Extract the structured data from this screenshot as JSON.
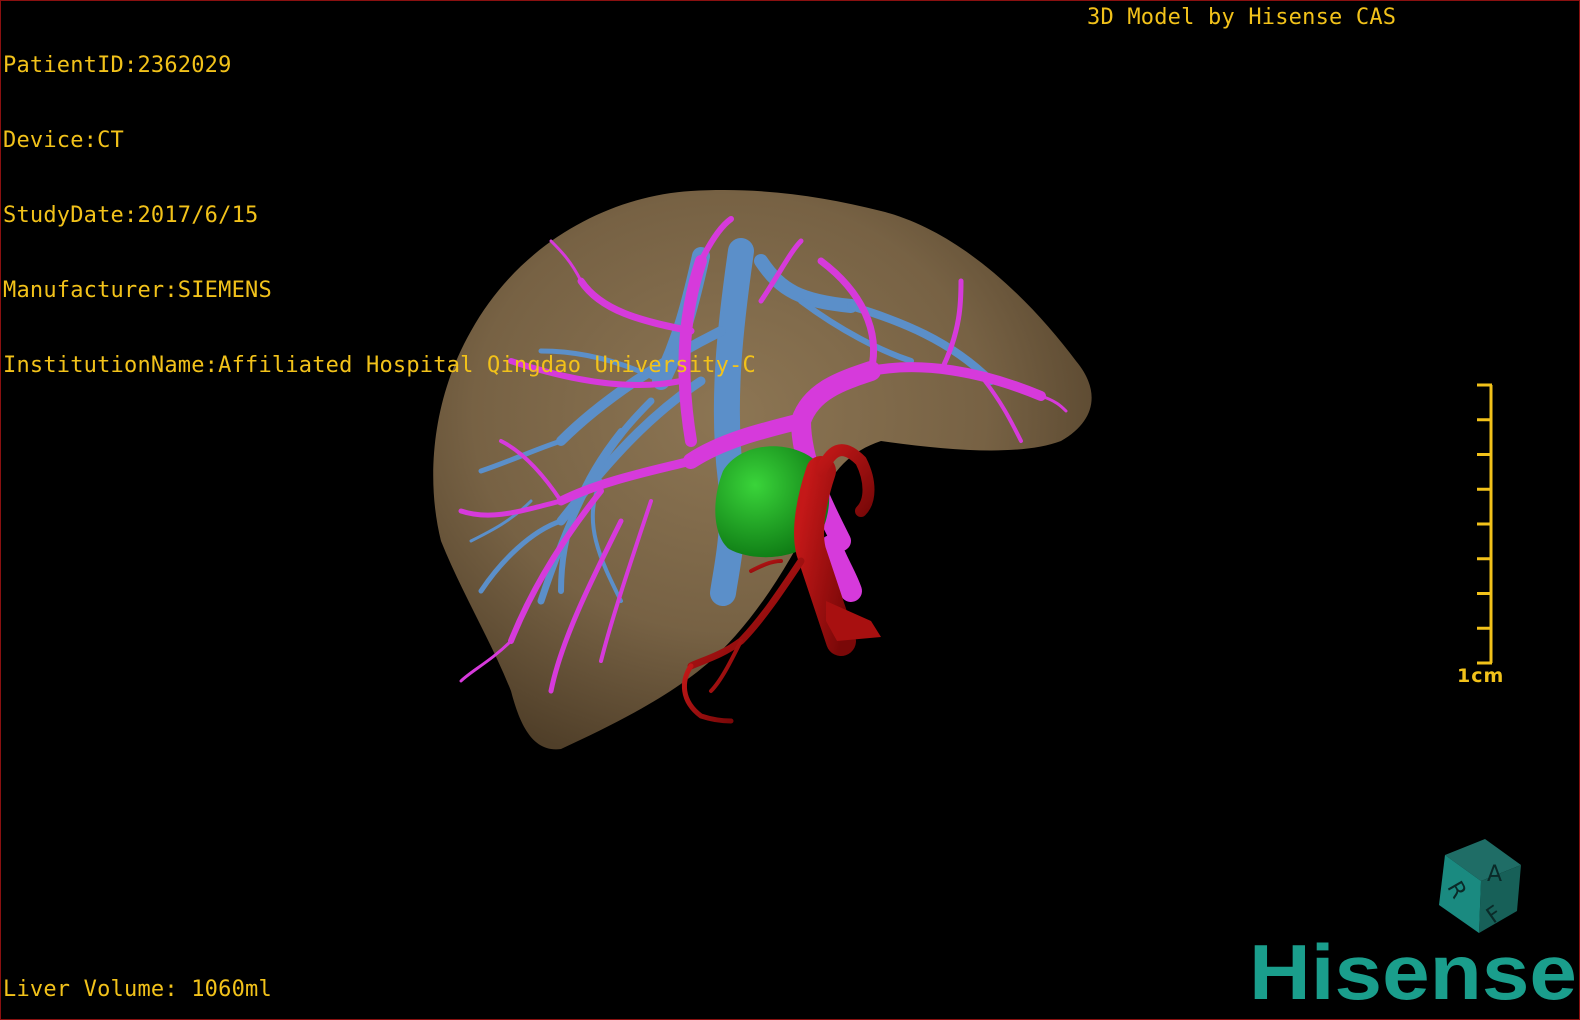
{
  "header": {
    "patient_id": "PatientID:2362029",
    "device": "Device:CT",
    "study_date": "StudyDate:2017/6/15",
    "manufacturer": "Manufacturer:SIEMENS",
    "institution": "InstitutionName:Affiliated Hospital Qingdao University-C",
    "model_credit": "3D Model by Hisense CAS"
  },
  "footer": {
    "liver_volume": "Liver Volume: 1060ml"
  },
  "scale_bar": {
    "label": "1cm",
    "ticks": 9
  },
  "orientation_cube": {
    "labels": [
      "R",
      "A",
      "F"
    ]
  },
  "brand": {
    "logo_text": "Hisense",
    "color": "#1a9e8c"
  },
  "colors": {
    "overlay_text": "#f2c21a",
    "liver": "#8c7350",
    "portal_vein": "#d63adb",
    "hepatic_vein": "#5b8fc9",
    "gallbladder": "#18a020",
    "artery": "#a81010",
    "border": "#8a1010"
  },
  "icons": {
    "orientation": "orientation-cube-icon",
    "logo": "hisense-logo-icon"
  }
}
